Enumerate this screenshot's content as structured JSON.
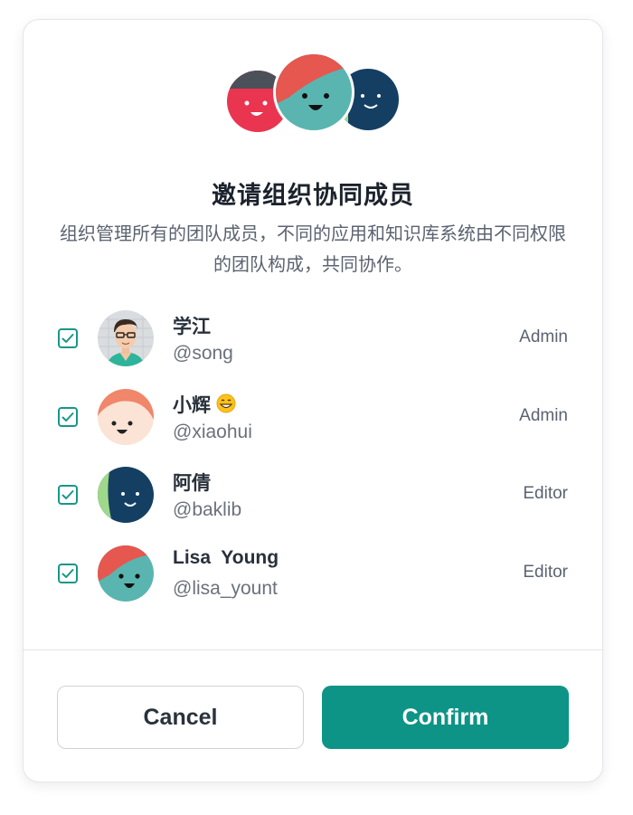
{
  "dialog": {
    "title": "邀请组织协同成员",
    "description": "组织管理所有的团队成员，不同的应用和知识库系统由不同权限的团队构成，共同协作。"
  },
  "members": [
    {
      "name": "学江",
      "handle": "@song",
      "role": "Admin",
      "checked": true,
      "avatar": "man-glasses-avatar"
    },
    {
      "name": "小辉",
      "handle": "@xiaohui",
      "role": "Admin",
      "checked": true,
      "avatar": "peach-face-avatar",
      "emoji": "grinning-emoji"
    },
    {
      "name": "阿倩",
      "handle": "@baklib",
      "role": "Editor",
      "checked": true,
      "avatar": "navy-face-avatar"
    },
    {
      "name": "Lisa  Young",
      "handle": "@lisa_yount",
      "role": "Editor",
      "checked": true,
      "avatar": "teal-face-avatar"
    }
  ],
  "buttons": {
    "cancel": "Cancel",
    "confirm": "Confirm"
  },
  "colors": {
    "accent": "#0e9486",
    "checkbox": "#17978a"
  }
}
